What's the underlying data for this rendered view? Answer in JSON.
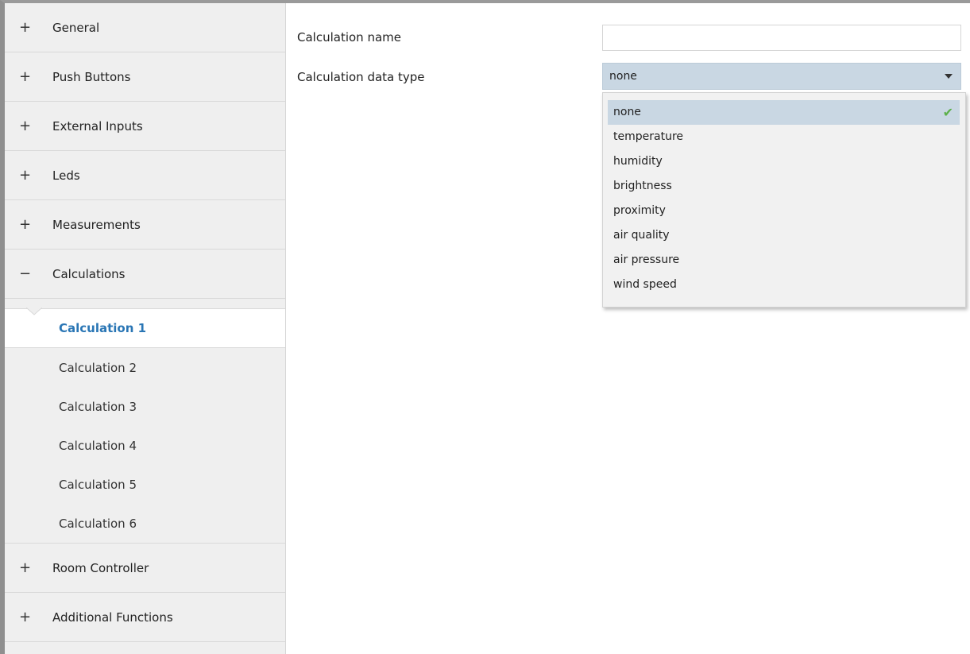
{
  "sidebar": {
    "groups_top": [
      {
        "symbol": "+",
        "label": "General"
      },
      {
        "symbol": "+",
        "label": "Push Buttons"
      },
      {
        "symbol": "+",
        "label": "External Inputs"
      },
      {
        "symbol": "+",
        "label": "Leds"
      },
      {
        "symbol": "+",
        "label": "Measurements"
      },
      {
        "symbol": "−",
        "label": "Calculations"
      }
    ],
    "sub_items": [
      {
        "label": "Calculation 1",
        "active": true
      },
      {
        "label": "Calculation 2"
      },
      {
        "label": "Calculation 3"
      },
      {
        "label": "Calculation 4"
      },
      {
        "label": "Calculation 5"
      },
      {
        "label": "Calculation 6"
      }
    ],
    "groups_bottom": [
      {
        "symbol": "+",
        "label": "Room Controller"
      },
      {
        "symbol": "+",
        "label": "Additional Functions"
      }
    ]
  },
  "form": {
    "name_label": "Calculation name",
    "name_value": "",
    "type_label": "Calculation data type",
    "type_value": "none",
    "options": [
      "none",
      "temperature",
      "humidity",
      "brightness",
      "proximity",
      "air quality",
      "air pressure",
      "wind speed"
    ],
    "selected_option": "none"
  },
  "icons": {
    "check": "check-icon",
    "caret": "caret-down-icon"
  },
  "colors": {
    "accent": "#2a76b5",
    "selection": "#c9d7e3",
    "check": "#5cb04a"
  }
}
